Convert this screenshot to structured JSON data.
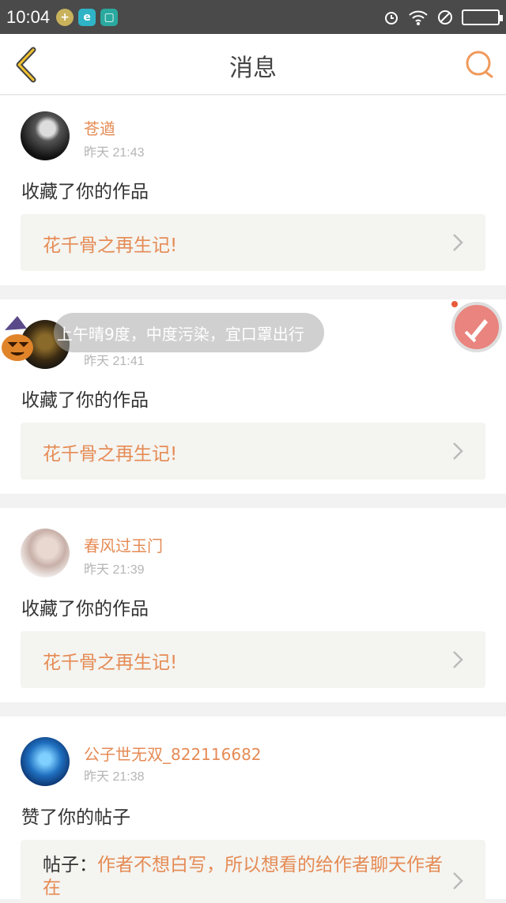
{
  "status_bar": {
    "time": "10:04"
  },
  "header": {
    "title": "消息"
  },
  "messages": [
    {
      "user": "苍遒",
      "time": "昨天 21:43",
      "action": "收藏了你的作品",
      "work_title": "花千骨之再生记!"
    },
    {
      "user": "",
      "time": "昨天 21:41",
      "action": "收藏了你的作品",
      "work_title": "花千骨之再生记!"
    },
    {
      "user": "春风过玉门",
      "time": "昨天 21:39",
      "action": "收藏了你的作品",
      "work_title": "花千骨之再生记!"
    },
    {
      "user": "公子世无双_822116682",
      "time": "昨天 21:38",
      "action": "赞了你的帖子",
      "post_label": "帖子：",
      "post_text": "作者不想白写，所以想看的给作者聊天作者在"
    }
  ],
  "overlay": {
    "weather_toast": "上午晴9度，中度污染，宜口罩出行"
  },
  "colors": {
    "accent": "#e58b55",
    "status_bar": "#4a4a4a"
  }
}
